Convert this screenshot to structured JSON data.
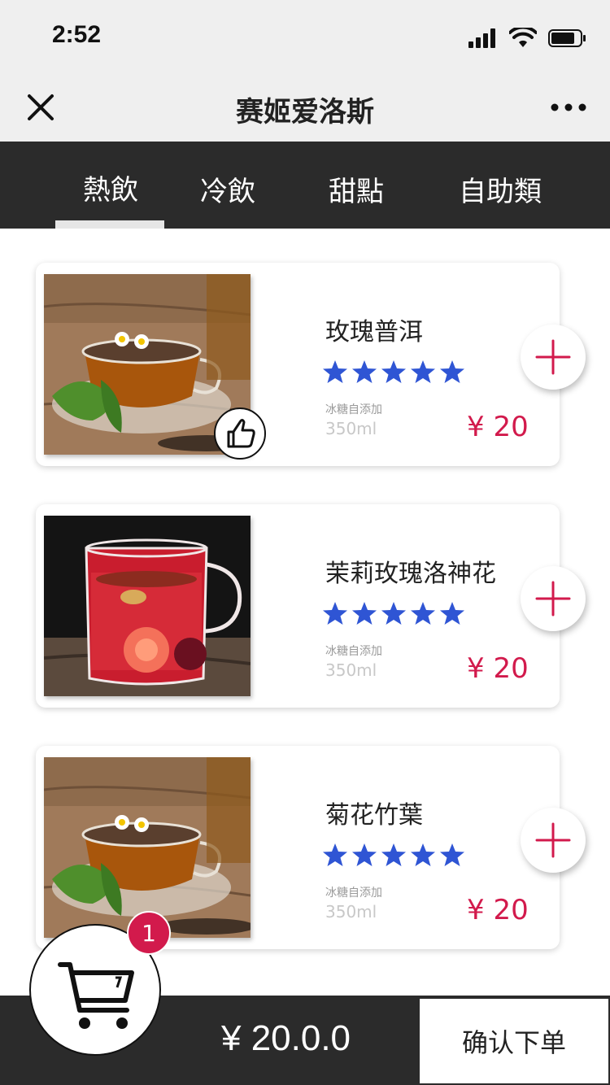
{
  "status_bar": {
    "time": "2:52"
  },
  "nav": {
    "title": "赛姬爱洛斯"
  },
  "tabs": [
    {
      "label": "熱飲",
      "selected": true
    },
    {
      "label": "冷飲",
      "selected": false
    },
    {
      "label": "甜點",
      "selected": false
    },
    {
      "label": "自助類",
      "selected": false
    }
  ],
  "products": [
    {
      "name": "玫瑰普洱",
      "rating": 5,
      "note": "冰糖自添加",
      "volume": "350ml",
      "price": "¥ 20",
      "recommended": true,
      "image": "amber-tea-cup"
    },
    {
      "name": "茉莉玫瑰洛神花",
      "rating": 5,
      "note": "冰糖自添加",
      "volume": "350ml",
      "price": "¥ 20",
      "recommended": false,
      "image": "red-flower-tea-cup"
    },
    {
      "name": "菊花竹葉",
      "rating": 5,
      "note": "冰糖自添加",
      "volume": "350ml",
      "price": "¥ 20",
      "recommended": false,
      "image": "amber-tea-cup"
    }
  ],
  "cart": {
    "count": "1",
    "total": "¥ 20.0.0",
    "confirm_label": "确认下单"
  },
  "colors": {
    "dark": "#2b2b2b",
    "accent": "#d21a4c",
    "star": "#2f55d4",
    "light": "#efefef"
  },
  "icons": [
    "close-icon",
    "more-icon",
    "plus-icon",
    "star-icon",
    "thumbs-up-icon",
    "cart-icon",
    "signal-icon",
    "wifi-icon",
    "battery-icon"
  ]
}
